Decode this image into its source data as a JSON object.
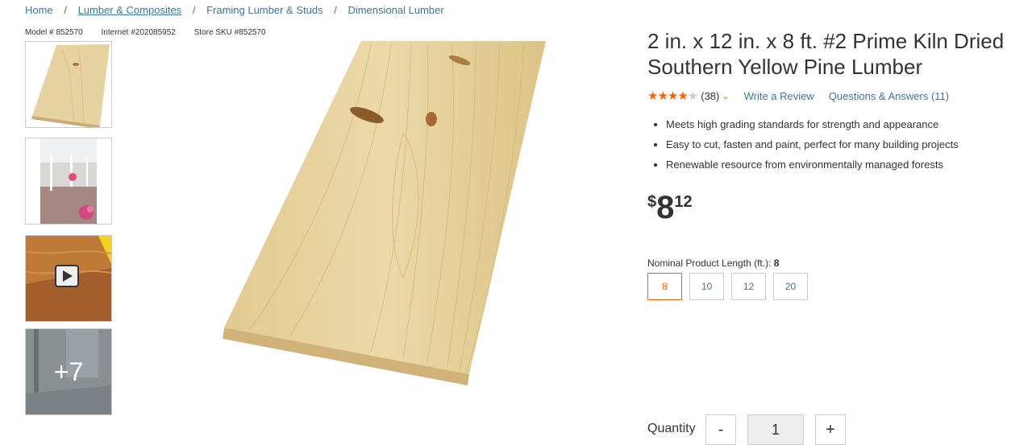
{
  "breadcrumb": {
    "items": [
      "Home",
      "Lumber & Composites",
      "Framing Lumber & Studs",
      "Dimensional Lumber"
    ],
    "separator": "/"
  },
  "ids": {
    "model": "Model # 852570",
    "internet": "Internet #202085952",
    "store_sku": "Store SKU #852570"
  },
  "thumbnails": {
    "more_label": "+7"
  },
  "product": {
    "title_line1": "2 in. x 12 in. x 8 ft. #2 Prime Kiln Dried",
    "title_line2": "Southern Yellow Pine Lumber",
    "rating": 4.5,
    "review_count": "(38)",
    "write_review": "Write a Review",
    "questions": "Questions & Answers (11)",
    "bullets": [
      "Meets high grading standards for strength and appearance",
      "Easy to cut, fasten and paint, perfect for many building projects",
      "Renewable resource from environmentally managed forests"
    ],
    "price": {
      "currency": "$",
      "dollars": "8",
      "cents": "12"
    }
  },
  "length": {
    "label": "Nominal Product Length (ft.):",
    "selected": "8",
    "options": [
      "8",
      "10",
      "12",
      "20"
    ]
  },
  "quantity": {
    "label": "Quantity",
    "value": "1",
    "minus": "-",
    "plus": "+"
  },
  "colors": {
    "accent": "#f96302",
    "link": "#3e7697"
  }
}
